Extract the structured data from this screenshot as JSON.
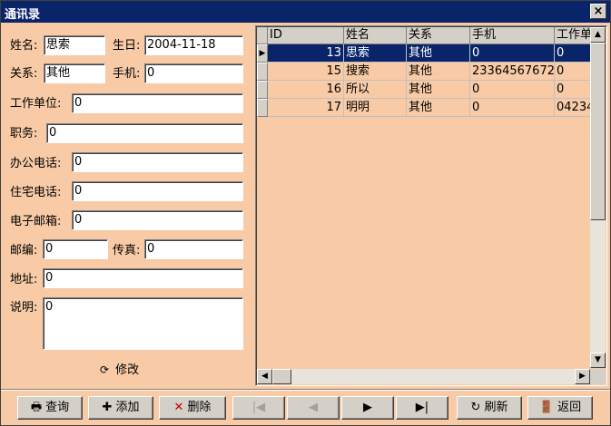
{
  "window": {
    "title": "通讯录",
    "close": "×"
  },
  "form": {
    "name": {
      "label": "姓名:",
      "value": "思索"
    },
    "birthday": {
      "label": "生日:",
      "value": "2004-11-18"
    },
    "relation": {
      "label": "关系:",
      "value": "其他"
    },
    "mobile": {
      "label": "手机:",
      "value": "0"
    },
    "work_unit": {
      "label": "工作单位:",
      "value": "0"
    },
    "position": {
      "label": "职务:",
      "value": "0"
    },
    "office_phone": {
      "label": "办公电话:",
      "value": "0"
    },
    "home_phone": {
      "label": "住宅电话:",
      "value": "0"
    },
    "email": {
      "label": "电子邮箱:",
      "value": "0"
    },
    "postcode": {
      "label": "邮编:",
      "value": "0"
    },
    "fax": {
      "label": "传真:",
      "value": "0"
    },
    "address": {
      "label": "地址:",
      "value": "0"
    },
    "notes": {
      "label": "说明:",
      "value": "0"
    },
    "modify_label": "修改"
  },
  "grid": {
    "columns": [
      "ID",
      "姓名",
      "关系",
      "手机",
      "工作单"
    ],
    "rows": [
      {
        "id": "13",
        "name": "思索",
        "relation": "其他",
        "mobile": "0",
        "work": "0",
        "selected": true
      },
      {
        "id": "15",
        "name": "搜索",
        "relation": "其他",
        "mobile": "23364567672",
        "work": "0"
      },
      {
        "id": "16",
        "name": "所以",
        "relation": "其他",
        "mobile": "0",
        "work": "0"
      },
      {
        "id": "17",
        "name": "明明",
        "relation": "其他",
        "mobile": "0",
        "work": "04234"
      }
    ]
  },
  "toolbar": {
    "query": "查询",
    "add": "添加",
    "delete": "删除",
    "refresh": "刷新",
    "back": "返回"
  },
  "colors": {
    "background": "#f8cba6",
    "titlebar": "#0a246a",
    "selection": "#0a246a"
  }
}
